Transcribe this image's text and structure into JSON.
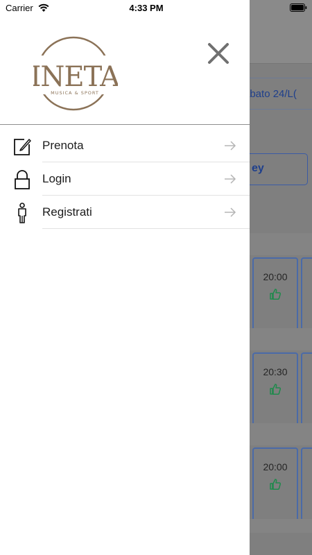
{
  "status_bar": {
    "carrier": "Carrier",
    "time": "4:33 PM"
  },
  "logo": {
    "text": "PINETAS",
    "tagline": "MUSICA & SPORT",
    "color": "#8b7257"
  },
  "drawer": {
    "close_icon": "close-icon",
    "menu": [
      {
        "label": "Prenota",
        "icon": "edit-icon"
      },
      {
        "label": "Login",
        "icon": "lock-icon"
      },
      {
        "label": "Registrati",
        "icon": "person-icon"
      }
    ]
  },
  "background": {
    "date_label": "abato 24/L(",
    "sport_label": "ey",
    "slots": [
      {
        "time": "20:00"
      },
      {
        "time": "20:30"
      },
      {
        "time": "20:00"
      }
    ]
  },
  "colors": {
    "accent": "#2f5cc0",
    "available": "#2ea05a",
    "arrow": "#b5b5b5"
  }
}
